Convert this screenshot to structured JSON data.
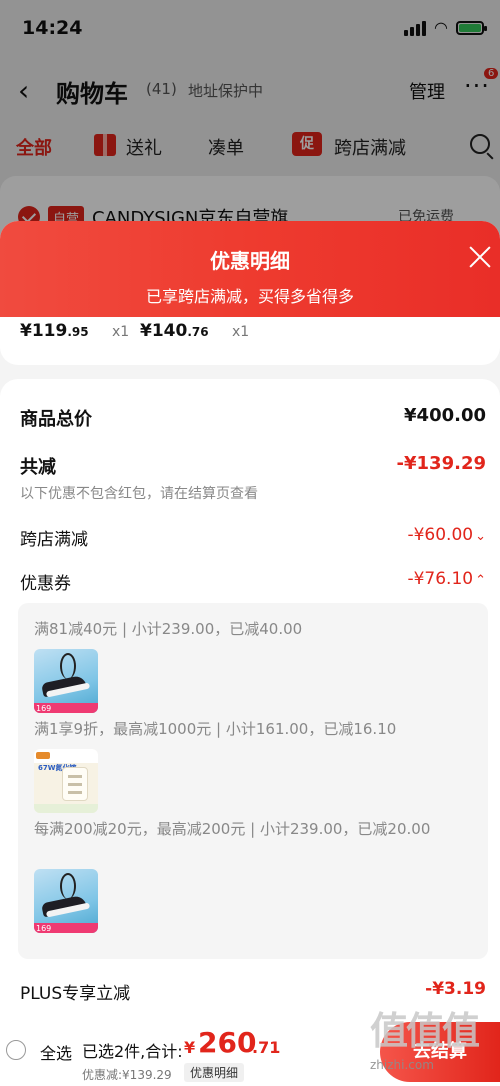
{
  "status": {
    "time": "14:24"
  },
  "nav": {
    "title": "购物车",
    "count": "(41)",
    "address_protect": "地址保护中",
    "manage": "管理",
    "more_badge": "6"
  },
  "tabs": {
    "all": "全部",
    "gift": "送礼",
    "combine": "凑单",
    "cross_store_icon": "促",
    "cross_store": "跨店满减"
  },
  "store": {
    "self_tag": "自营",
    "name": "CANDYSIGN京东自营旗...",
    "free_shipping": "已免运费"
  },
  "sheet": {
    "title": "优惠明细",
    "subtitle": "已享跨店满减，买得多省得多"
  },
  "goods": [
    {
      "price_int": "¥119",
      "price_dec": ".95",
      "qty": "x1"
    },
    {
      "price_int": "¥140",
      "price_dec": ".76",
      "qty": "x1"
    }
  ],
  "details": {
    "total_label": "商品总价",
    "total_value": "¥400.00",
    "reduce_label": "共减",
    "reduce_value": "-¥139.29",
    "reduce_note": "以下优惠不包含红包，请在结算页查看",
    "cross_label": "跨店满减",
    "cross_value": "-¥60.00",
    "coupon_label": "优惠券",
    "coupon_value": "-¥76.10",
    "plus_label": "PLUS专享立减",
    "plus_value": "-¥3.19"
  },
  "coupons": [
    {
      "rule": "满81减40元 | 小计239.00，已减40.00",
      "thumb": "shoe",
      "tag": "169"
    },
    {
      "rule": "满1享9折，最高减1000元 | 小计161.00，已减16.10",
      "thumb": "charger",
      "tag": "67W氮化镓"
    },
    {
      "rule": "每满200减20元，最高减200元 | 小计239.00，已减20.00",
      "thumb": "shoe",
      "tag": "169"
    }
  ],
  "bottom": {
    "select_all": "全选",
    "selected": "已选2件,合计:",
    "yen": "¥",
    "total_int": "260",
    "total_dec": ".71",
    "discount": "优惠减:¥139.29",
    "discount_link": "优惠明细",
    "checkout": "去结算"
  },
  "watermark": {
    "logo": "值值值",
    "url": "zhizhi.com"
  },
  "colors": {
    "accent": "#e1251b",
    "header_gradient_start": "#f04b3f",
    "header_gradient_end": "#e92e28"
  },
  "icons": [
    "back-icon",
    "more-icon",
    "gift-icon",
    "search-icon",
    "check-icon",
    "close-icon",
    "chevron-down-icon",
    "chevron-up-icon"
  ]
}
